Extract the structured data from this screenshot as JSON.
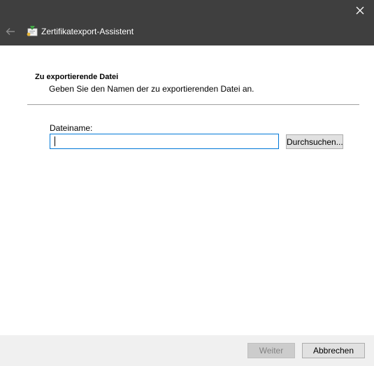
{
  "window": {
    "title": "Zertifikatexport-Assistent",
    "icons": {
      "back": "back-arrow-icon",
      "close": "close-icon",
      "app": "certificate-wizard-icon"
    }
  },
  "section": {
    "heading": "Zu exportierende Datei",
    "subtitle": "Geben Sie den Namen der zu exportierenden Datei an."
  },
  "file": {
    "label": "Dateiname:",
    "value": "",
    "placeholder": "",
    "browse_label": "Durchsuchen..."
  },
  "footer": {
    "next_label": "Weiter",
    "next_enabled": false,
    "cancel_label": "Abbrechen"
  },
  "colors": {
    "titlebar": "#3f3f3f",
    "input_focus_border": "#0078d7",
    "footer": "#f0f0f0"
  }
}
